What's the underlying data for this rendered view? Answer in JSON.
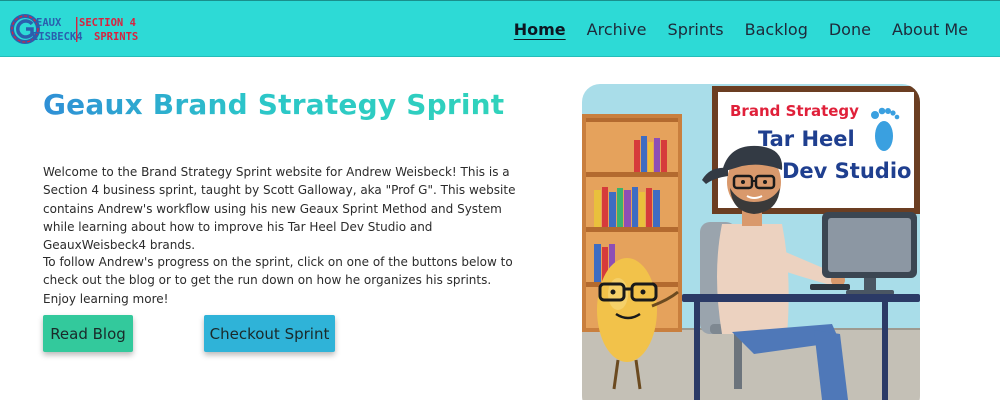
{
  "logo": {
    "line1_left": "EAUX",
    "line1_right": "SECTION 4",
    "line2_left": "EISBECK4",
    "line2_right": "SPRINTS",
    "colors": {
      "blue": "#2a5fae",
      "red": "#d8233f"
    }
  },
  "nav": {
    "items": [
      {
        "label": "Home",
        "active": true
      },
      {
        "label": "Archive"
      },
      {
        "label": "Sprints"
      },
      {
        "label": "Backlog"
      },
      {
        "label": "Done"
      },
      {
        "label": "About Me"
      }
    ]
  },
  "hero": {
    "title": "Geaux Brand Strategy Sprint",
    "intro": "Welcome to the Brand Strategy Sprint website for Andrew Weisbeck! This is a Section 4 business sprint, taught by Scott Galloway, aka \"Prof G\". This website contains Andrew's workflow using his new Geaux Sprint Method and System while learning about how to improve his Tar Heel Dev Studio and GeauxWeisbeck4 brands.",
    "follow": "To follow Andrew's progress on the sprint, click on one of the buttons below to check out the blog or to get the run down on how he organizes his sprints. Enjoy learning more!",
    "buttons": {
      "blog": "Read Blog",
      "sprint": "Checkout Sprint"
    }
  },
  "illustration": {
    "sign_line1": "Brand Strategy",
    "sign_line2": "Tar Heel",
    "sign_line3": "Dev Studio"
  },
  "colors": {
    "navbar": "#2ddad6",
    "title_gradient_start": "#2f8fd6",
    "title_gradient_end": "#31d6b8",
    "button_blog": "#33c99c",
    "button_sprint": "#2fb3d8"
  }
}
